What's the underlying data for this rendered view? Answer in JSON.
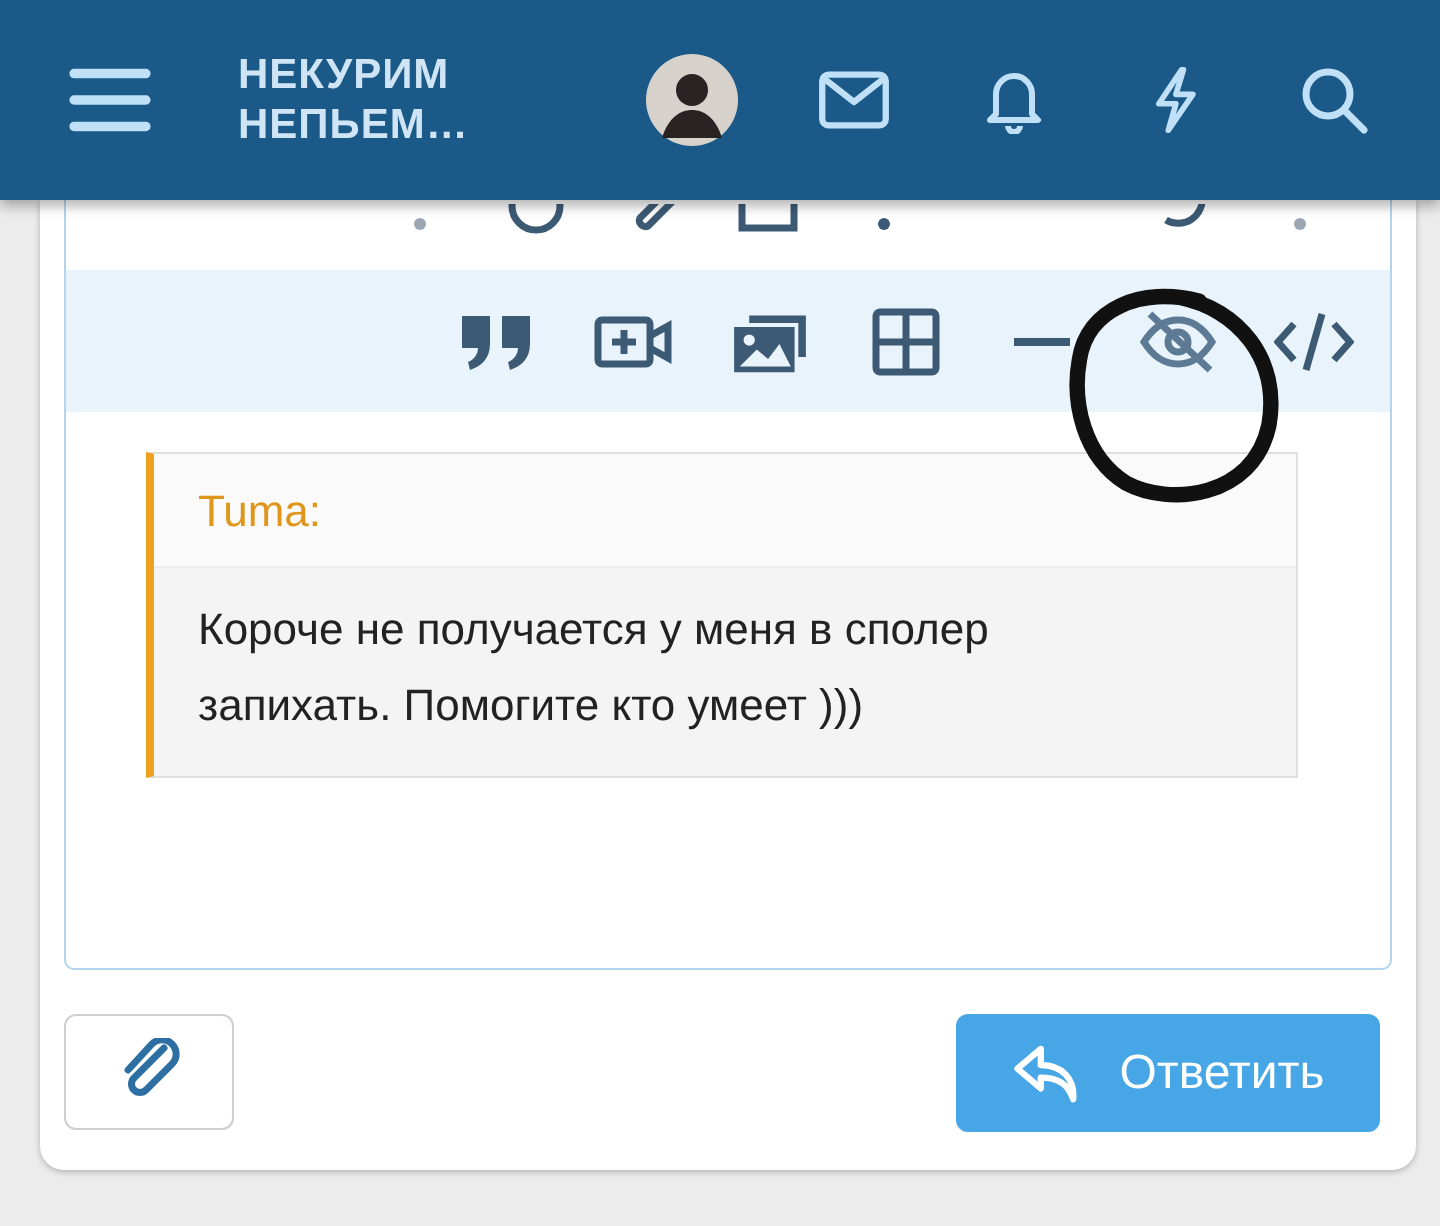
{
  "header": {
    "logo_lines": [
      "НЕКУРИМ",
      "НЕПЬЕМ…"
    ]
  },
  "quote": {
    "author": "Tuma:",
    "text": "Короче не получается у меня в сполер запихать. Помогите кто умеет )))"
  },
  "reply_button": {
    "label": "Ответить"
  }
}
